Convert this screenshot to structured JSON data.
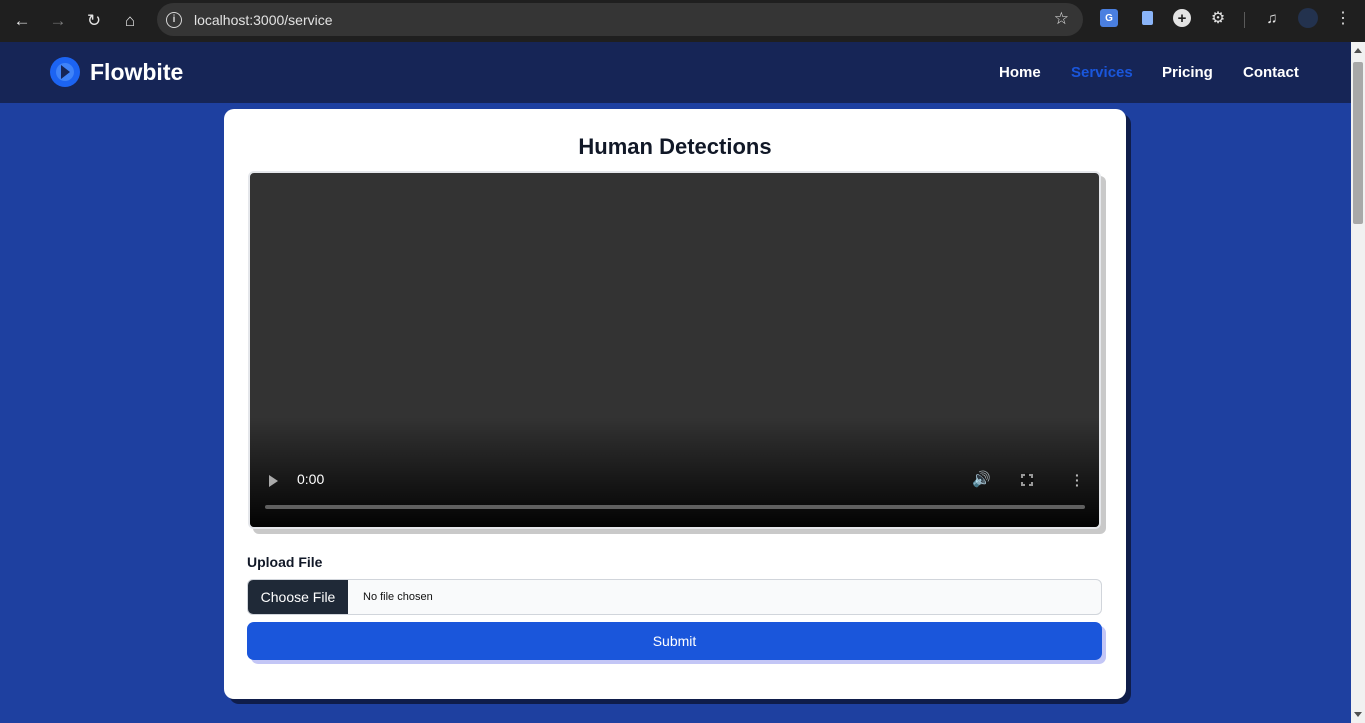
{
  "browser": {
    "url": "localhost:3000/service"
  },
  "navbar": {
    "brand": "Flowbite",
    "links": [
      {
        "label": "Home",
        "active": false
      },
      {
        "label": "Services",
        "active": true
      },
      {
        "label": "Pricing",
        "active": false
      },
      {
        "label": "Contact",
        "active": false
      }
    ]
  },
  "main": {
    "title": "Human Detections",
    "video": {
      "time": "0:00"
    },
    "upload": {
      "label": "Upload File",
      "choose_button": "Choose File",
      "status": "No file chosen"
    },
    "submit_label": "Submit"
  },
  "colors": {
    "page_bg": "#1e40a0",
    "navbar_bg": "#162556",
    "accent": "#1a56db",
    "active_link": "#1a56db"
  }
}
